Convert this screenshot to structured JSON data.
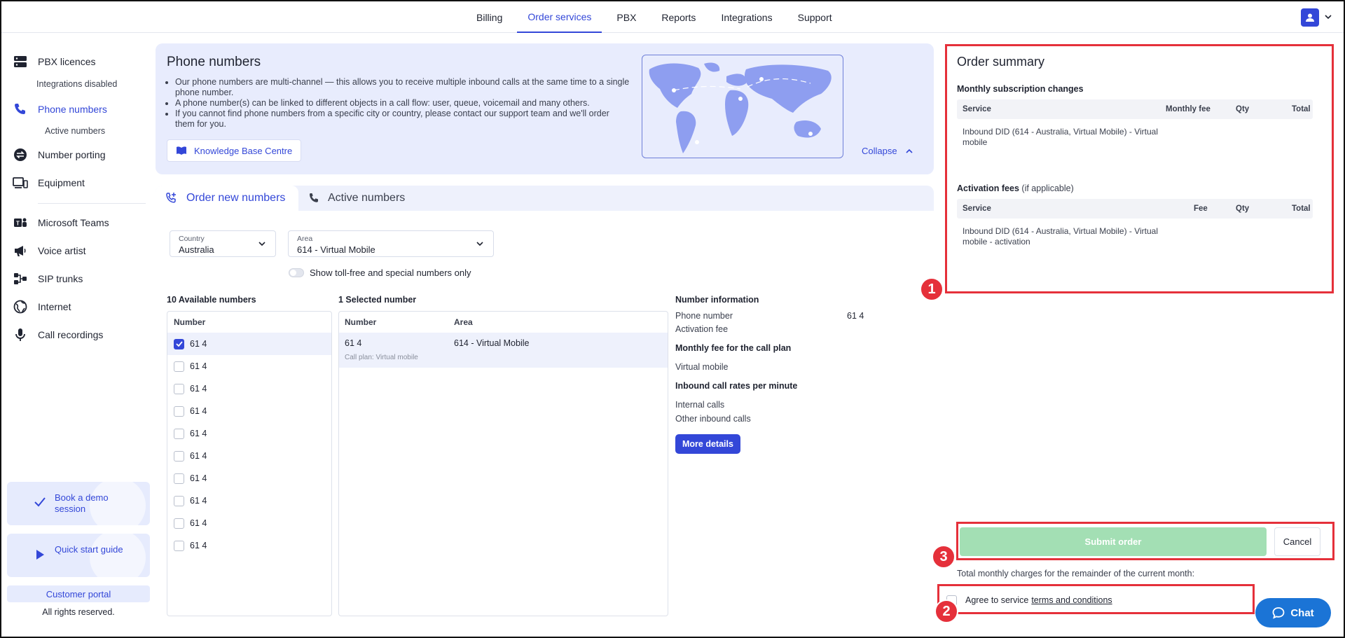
{
  "topnav": {
    "tabs": [
      {
        "label": "Billing"
      },
      {
        "label": "Order services",
        "active": true
      },
      {
        "label": "PBX"
      },
      {
        "label": "Reports"
      },
      {
        "label": "Integrations"
      },
      {
        "label": "Support"
      }
    ]
  },
  "sidebar": {
    "pbx": "PBX licences",
    "integrations_sub": "Integrations disabled",
    "phone_numbers": "Phone numbers",
    "active_numbers_sub": "Active numbers",
    "number_porting": "Number porting",
    "equipment": "Equipment",
    "teams": "Microsoft Teams",
    "voice_artist": "Voice artist",
    "sip_trunks": "SIP trunks",
    "internet": "Internet",
    "call_recordings": "Call recordings",
    "demo": "Book a demo session",
    "guide": "Quick start guide",
    "portal": "Customer portal",
    "rights": "All rights reserved."
  },
  "hero": {
    "title": "Phone numbers",
    "bullets": [
      "Our phone numbers are multi-channel — this allows you to receive multiple inbound calls at the same time to a single phone number.",
      "A phone number(s) can be linked to different objects in a call flow: user, queue, voicemail and many others.",
      "If you cannot find phone numbers from a specific city or country, please contact our support team and we'll order them for you."
    ],
    "kb_button": "Knowledge Base Centre",
    "collapse": "Collapse"
  },
  "order_tabs": {
    "new": "Order new numbers",
    "active": "Active numbers"
  },
  "filters": {
    "country_label": "Country",
    "country_value": "Australia",
    "area_label": "Area",
    "area_value": "614 - Virtual Mobile",
    "toggle_label": "Show toll-free and special numbers only"
  },
  "available": {
    "title": "10 Available numbers",
    "col_number": "Number",
    "rows": [
      "61 4",
      "61 4",
      "61 4",
      "61 4",
      "61 4",
      "61 4",
      "61 4",
      "61 4",
      "61 4",
      "61 4"
    ]
  },
  "selected": {
    "title": "1 Selected number",
    "col_number": "Number",
    "col_area": "Area",
    "number": "61 4",
    "area": "614 - Virtual Mobile",
    "plan": "Call plan: Virtual mobile"
  },
  "number_info": {
    "title": "Number information",
    "phone_label": "Phone number",
    "phone_value": "61 4",
    "activation_label": "Activation fee",
    "monthly_title": "Monthly fee for the call plan",
    "plan": "Virtual mobile",
    "rates_title": "Inbound call rates per minute",
    "internal": "Internal calls",
    "other": "Other inbound calls",
    "more_button": "More details"
  },
  "summary": {
    "title": "Order summary",
    "monthly_title": "Monthly subscription changes",
    "monthly_cols": {
      "service": "Service",
      "fee": "Monthly fee",
      "qty": "Qty",
      "total": "Total"
    },
    "monthly_line": "Inbound DID (614 - Australia, Virtual Mobile) - Virtual mobile",
    "activation_title": "Activation fees",
    "activation_note": "(if applicable)",
    "activation_cols": {
      "service": "Service",
      "fee": "Fee",
      "qty": "Qty",
      "total": "Total"
    },
    "activation_line": "Inbound DID (614 - Australia, Virtual Mobile) - Virtual mobile - activation",
    "submit": "Submit order",
    "cancel": "Cancel",
    "total_label": "Total monthly charges for the remainder of the current month:",
    "agree": "Agree to service",
    "terms": "terms and conditions"
  },
  "chat": "Chat",
  "annotations": [
    "1",
    "2",
    "3"
  ],
  "colors": {
    "accent": "#3347d8",
    "submit_disabled": "#a3dfb4",
    "annotation": "#e5303a",
    "chat": "#1b74d6"
  }
}
